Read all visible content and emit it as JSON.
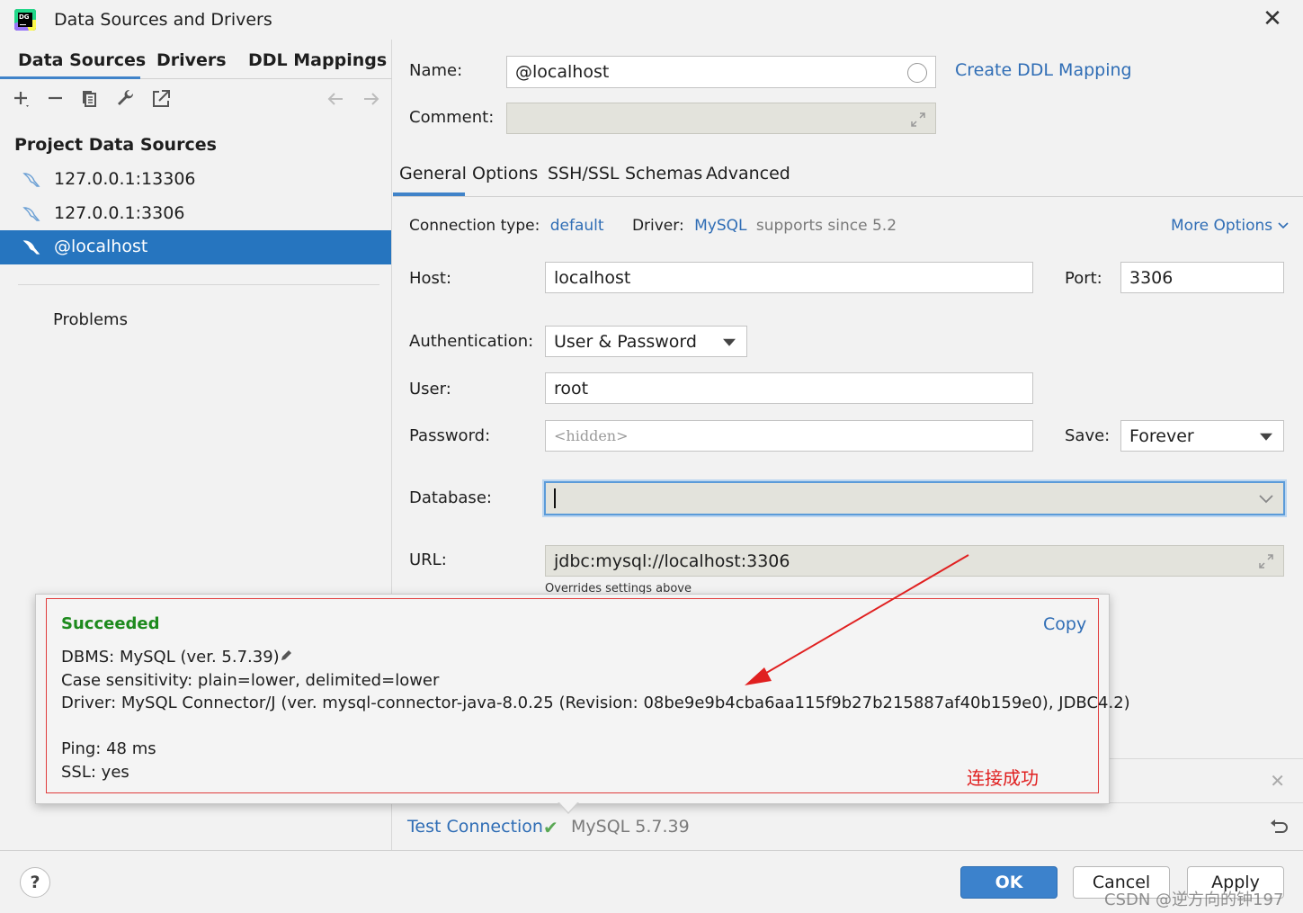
{
  "window": {
    "title": "Data Sources and Drivers",
    "logo_text": "DG"
  },
  "left": {
    "tabs": [
      "Data Sources",
      "Drivers",
      "DDL Mappings"
    ],
    "section_title": "Project Data Sources",
    "items": [
      "127.0.0.1:13306",
      "127.0.0.1:3306",
      "@localhost"
    ],
    "problems": "Problems"
  },
  "form": {
    "name_label": "Name:",
    "name_value": "@localhost",
    "create_ddl": "Create DDL Mapping",
    "comment_label": "Comment:",
    "tabs": [
      "General",
      "Options",
      "SSH/SSL",
      "Schemas",
      "Advanced"
    ],
    "conn_type_label": "Connection type:",
    "conn_type_value": "default",
    "driver_label": "Driver:",
    "driver_value": "MySQL",
    "driver_suffix": "supports since 5.2",
    "more_options": "More Options",
    "host_label": "Host:",
    "host_value": "localhost",
    "port_label": "Port:",
    "port_value": "3306",
    "auth_label": "Authentication:",
    "auth_value": "User & Password",
    "user_label": "User:",
    "user_value": "root",
    "password_label": "Password:",
    "password_placeholder": "<hidden>",
    "save_label": "Save:",
    "save_value": "Forever",
    "database_label": "Database:",
    "url_label": "URL:",
    "url_value": "jdbc:mysql://localhost:3306",
    "url_hint": "Overrides settings above"
  },
  "popup": {
    "status": "Succeeded",
    "copy": "Copy",
    "dbms": "DBMS: MySQL (ver. 5.7.39)",
    "case": "Case sensitivity: plain=lower, delimited=lower",
    "driver": "Driver: MySQL Connector/J (ver. mysql-connector-java-8.0.25 (Revision: 08be9e9b4cba6aa115f9b27b215887af40b159e0), JDBC4.2)",
    "ping": "Ping: 48 ms",
    "ssl": "SSL: yes",
    "annotation": "连接成功"
  },
  "bottom": {
    "test_connection": "Test Connection",
    "version": "MySQL 5.7.39",
    "help": "?",
    "ok": "OK",
    "cancel": "Cancel",
    "apply": "Apply",
    "watermark": "CSDN @逆方向的钟197"
  },
  "colors": {
    "accent": "#2675bf",
    "link": "#2f6db5",
    "success": "#1d8a1d",
    "annotation": "#e02020"
  }
}
